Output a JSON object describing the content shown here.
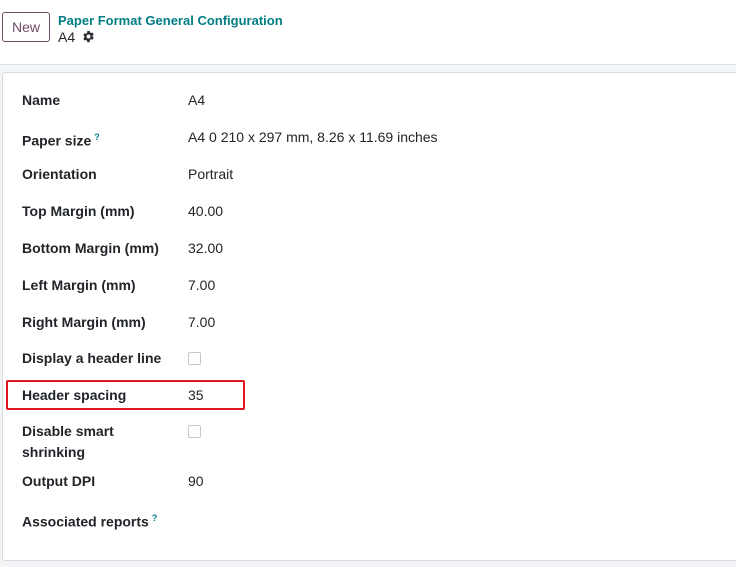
{
  "control_panel": {
    "new_button": "New",
    "breadcrumb": "Paper Format General Configuration",
    "record_name": "A4",
    "settings_icon": "gear-icon"
  },
  "form": {
    "name": {
      "label": "Name",
      "value": "A4"
    },
    "paper_size": {
      "label": "Paper size",
      "help": "?",
      "value": "A4 0 210 x 297 mm, 8.26 x 11.69 inches"
    },
    "orientation": {
      "label": "Orientation",
      "value": "Portrait"
    },
    "top_margin": {
      "label": "Top Margin (mm)",
      "value": "40.00"
    },
    "bottom_margin": {
      "label": "Bottom Margin (mm)",
      "value": "32.00"
    },
    "left_margin": {
      "label": "Left Margin (mm)",
      "value": "7.00"
    },
    "right_margin": {
      "label": "Right Margin (mm)",
      "value": "7.00"
    },
    "header_line": {
      "label": "Display a header line",
      "checked": false
    },
    "header_spacing": {
      "label": "Header spacing",
      "value": "35"
    },
    "disable_shrinking": {
      "label": "Disable smart shrinking",
      "checked": false
    },
    "output_dpi": {
      "label": "Output DPI",
      "value": "90"
    },
    "associated_reports": {
      "label": "Associated reports",
      "help": "?"
    }
  },
  "colors": {
    "brand": "#714b67",
    "link": "#017e84",
    "highlight": "#e0151e"
  }
}
